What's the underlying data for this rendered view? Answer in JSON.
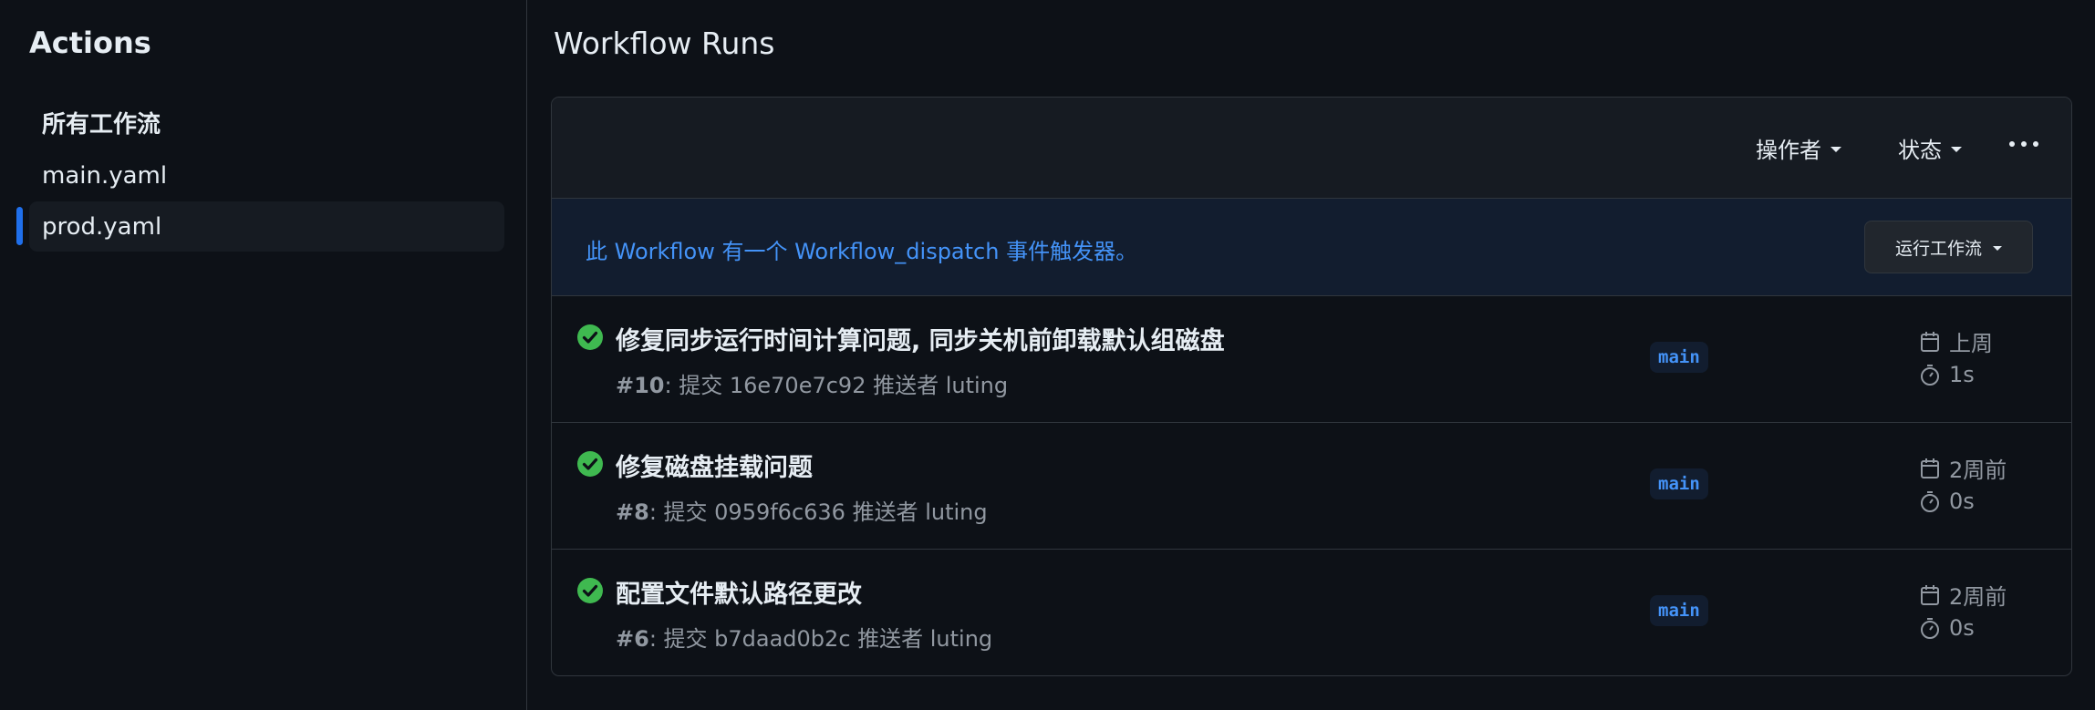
{
  "sidebar": {
    "title": "Actions",
    "items": [
      {
        "label": "所有工作流"
      },
      {
        "label": "main.yaml"
      },
      {
        "label": "prod.yaml",
        "selected": true
      }
    ]
  },
  "main": {
    "title": "Workflow Runs",
    "filters": {
      "actor": "操作者",
      "status": "状态"
    },
    "dispatch": {
      "message": "此 Workflow 有一个 Workflow_dispatch 事件触发器。",
      "button": "运行工作流"
    },
    "runs": [
      {
        "title": "修复同步运行时间计算问题, 同步关机前卸载默认组磁盘",
        "number": "#10",
        "meta": ": 提交 16e70e7c92 推送者 luting",
        "branch": "main",
        "when": "上周",
        "duration": "1s",
        "status": "success"
      },
      {
        "title": "修复磁盘挂载问题",
        "number": "#8",
        "meta": ": 提交 0959f6c636 推送者 luting",
        "branch": "main",
        "when": "2周前",
        "duration": "0s",
        "status": "success"
      },
      {
        "title": "配置文件默认路径更改",
        "number": "#6",
        "meta": ": 提交 b7daad0b2c 推送者 luting",
        "branch": "main",
        "when": "2周前",
        "duration": "0s",
        "status": "success"
      }
    ]
  },
  "colors": {
    "background": "#0d1117",
    "accent": "#4493f8",
    "success": "#3fb950",
    "selected_indicator": "#1f6feb"
  },
  "icons": {
    "status": "check-circle-icon",
    "when": "calendar-icon",
    "duration": "stopwatch-icon",
    "more": "kebab-horizontal-icon",
    "dropdown": "triangle-down-icon"
  }
}
